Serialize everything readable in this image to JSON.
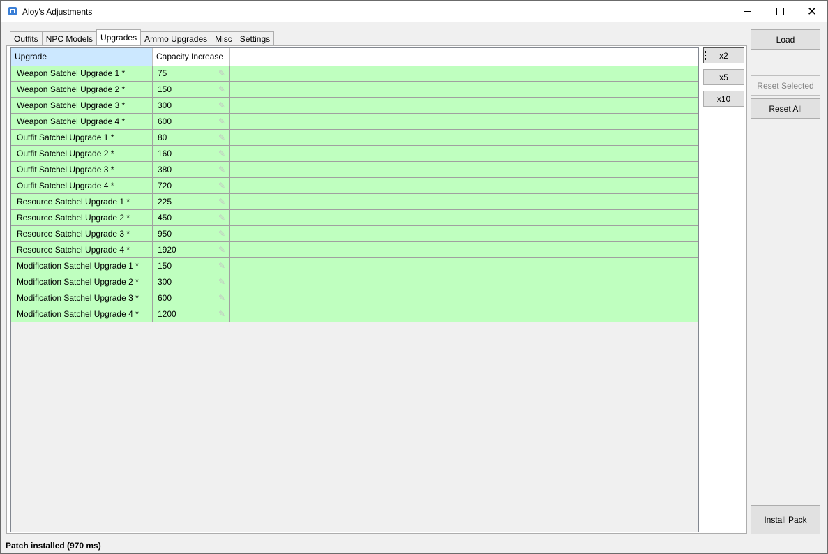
{
  "window": {
    "title": "Aloy's Adjustments"
  },
  "tabs": [
    "Outfits",
    "NPC Models",
    "Upgrades",
    "Ammo Upgrades",
    "Misc",
    "Settings"
  ],
  "active_tab": "Upgrades",
  "grid": {
    "columns": [
      "Upgrade",
      "Capacity Increase"
    ],
    "rows": [
      {
        "name": "Weapon Satchel Upgrade 1 *",
        "value": "75"
      },
      {
        "name": "Weapon Satchel Upgrade 2 *",
        "value": "150"
      },
      {
        "name": "Weapon Satchel Upgrade 3 *",
        "value": "300"
      },
      {
        "name": "Weapon Satchel Upgrade 4 *",
        "value": "600"
      },
      {
        "name": "Outfit Satchel Upgrade 1 *",
        "value": "80"
      },
      {
        "name": "Outfit Satchel Upgrade 2 *",
        "value": "160"
      },
      {
        "name": "Outfit Satchel Upgrade 3 *",
        "value": "380"
      },
      {
        "name": "Outfit Satchel Upgrade 4 *",
        "value": "720"
      },
      {
        "name": "Resource Satchel Upgrade 1 *",
        "value": "225"
      },
      {
        "name": "Resource Satchel Upgrade 2 *",
        "value": "450"
      },
      {
        "name": "Resource Satchel Upgrade 3 *",
        "value": "950"
      },
      {
        "name": "Resource Satchel Upgrade 4 *",
        "value": "1920"
      },
      {
        "name": "Modification Satchel Upgrade 1 *",
        "value": "150"
      },
      {
        "name": "Modification Satchel Upgrade 2 *",
        "value": "300"
      },
      {
        "name": "Modification Satchel Upgrade 3 *",
        "value": "600"
      },
      {
        "name": "Modification Satchel Upgrade 4 *",
        "value": "1200"
      }
    ]
  },
  "multiplier_buttons": {
    "x2": "x2",
    "x5": "x5",
    "x10": "x10"
  },
  "side_buttons": {
    "load": "Load",
    "reset_selected": "Reset Selected",
    "reset_all": "Reset All",
    "install_pack": "Install Pack"
  },
  "status": "Patch installed (970 ms)",
  "colors": {
    "row_bg": "#bfffbf",
    "header_selected": "#cce8ff"
  },
  "icons": {
    "edit": "pencil-icon"
  }
}
